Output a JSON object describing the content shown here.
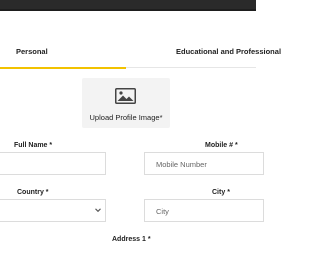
{
  "tabs": [
    {
      "label": "Personal",
      "active": true
    },
    {
      "label": "Educational and Professional",
      "active": false
    }
  ],
  "upload": {
    "label": "Upload Profile Image",
    "required": "*",
    "icon": "image-icon"
  },
  "fields": {
    "full_name": {
      "label": "Full Name",
      "required": "*",
      "value": ""
    },
    "mobile": {
      "label": "Mobile #",
      "required": "*",
      "placeholder": "Mobile Number"
    },
    "country": {
      "label": "Country",
      "required": "*",
      "value": "",
      "icon": "chevron-down-icon"
    },
    "city": {
      "label": "City",
      "required": "*",
      "placeholder": "City"
    },
    "address": {
      "label": "Address 1",
      "required": "*"
    }
  },
  "colors": {
    "accent": "#f2c200",
    "border": "#dcdcdc",
    "upload_bg": "#f3f3f3"
  }
}
